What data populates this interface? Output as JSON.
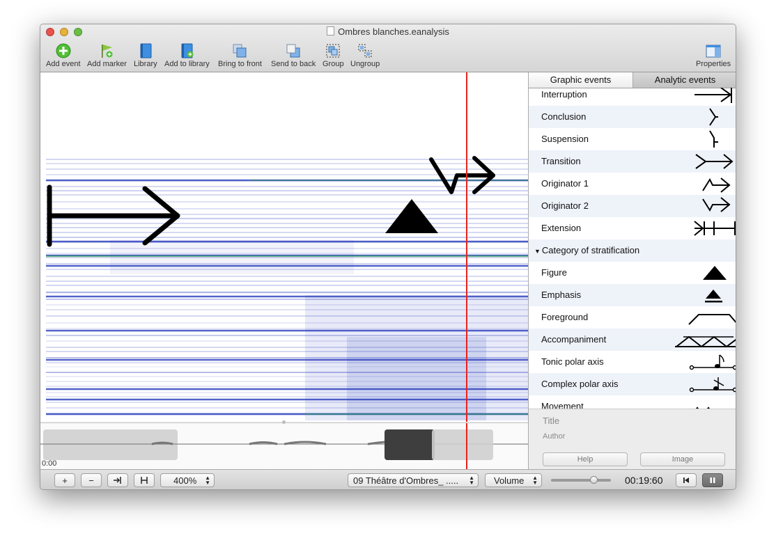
{
  "window": {
    "title": "Ombres blanches.eanalysis"
  },
  "toolbar": {
    "add_event": "Add event",
    "add_marker": "Add marker",
    "library": "Library",
    "add_to_library": "Add to library",
    "bring_to_front": "Bring to front",
    "send_to_back": "Send to back",
    "group": "Group",
    "ungroup": "Ungroup",
    "properties": "Properties"
  },
  "timeline": {
    "start_time": "0:00"
  },
  "bottom": {
    "add_label": "+",
    "remove_label": "−",
    "zoom_value": "400%",
    "track_value": "09 Théâtre d'Ombres_ .....",
    "mode_value": "Volume",
    "volume_level": 0.75,
    "time": "00:19:60"
  },
  "panel": {
    "tabs": [
      "Graphic events",
      "Analytic events"
    ],
    "active_tab": 1,
    "items": [
      {
        "label": "Interruption",
        "icon": "interruption-symbol"
      },
      {
        "label": "Conclusion",
        "icon": "conclusion-symbol"
      },
      {
        "label": "Suspension",
        "icon": "suspension-symbol"
      },
      {
        "label": "Transition",
        "icon": "transition-symbol"
      },
      {
        "label": "Originator 1",
        "icon": "originator-1-symbol"
      },
      {
        "label": "Originator 2",
        "icon": "originator-2-symbol"
      },
      {
        "label": "Extension",
        "icon": "extension-symbol"
      },
      {
        "label": "Category of stratification",
        "category": true
      },
      {
        "label": "Figure",
        "icon": "figure-triangle"
      },
      {
        "label": "Emphasis",
        "icon": "emphasis-triangle"
      },
      {
        "label": "Foreground",
        "icon": "foreground-symbol"
      },
      {
        "label": "Accompaniment",
        "icon": "accompaniment-symbol"
      },
      {
        "label": "Tonic polar axis",
        "icon": "tonic-polar-axis-symbol"
      },
      {
        "label": "Complex polar axis",
        "icon": "complex-polar-axis-symbol"
      },
      {
        "label": "Movement",
        "icon": "movement-symbol"
      }
    ],
    "meta": {
      "title_placeholder": "Title",
      "author_placeholder": "Author",
      "help": "Help",
      "image": "Image"
    }
  },
  "colors": {
    "playhead": "#e8231e",
    "spectrum": "#1a2fb8",
    "accent_green": "#2aa84a"
  }
}
